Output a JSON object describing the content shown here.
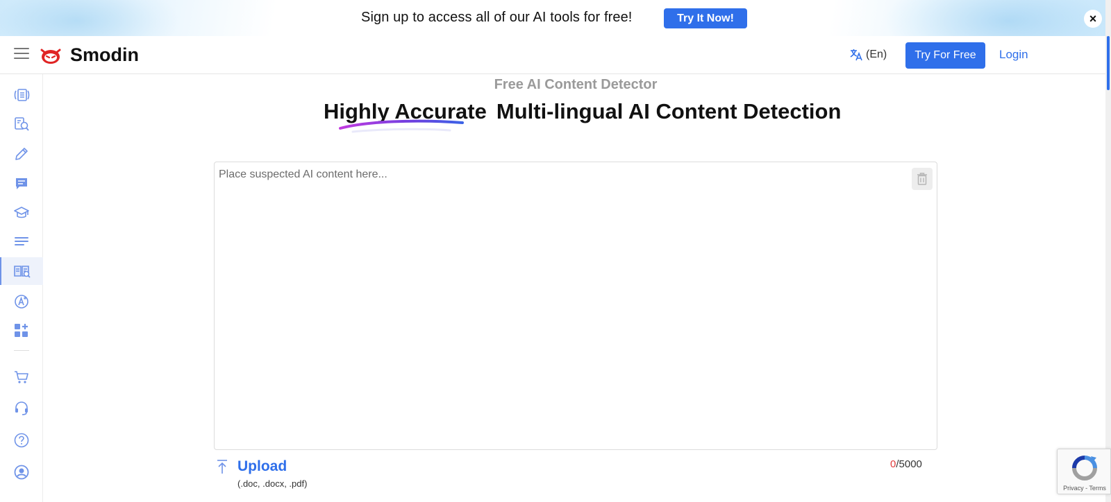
{
  "banner": {
    "text": "Sign up to access all of our AI tools for free!",
    "button_label": "Try It Now!",
    "close_label": "×"
  },
  "header": {
    "brand": "Smodin",
    "language": "(En)",
    "try_free_label": "Try For Free",
    "login_label": "Login"
  },
  "sidebar": {
    "items": [
      {
        "icon": "rewrite-icon"
      },
      {
        "icon": "plagiarism-search-icon"
      },
      {
        "icon": "pencil-icon"
      },
      {
        "icon": "chat-icon"
      },
      {
        "icon": "graduation-cap-icon"
      },
      {
        "icon": "text-lines-icon"
      },
      {
        "icon": "ai-detector-icon",
        "active": true
      },
      {
        "icon": "ai-grader-icon"
      },
      {
        "icon": "apps-add-icon"
      },
      {
        "icon": "cart-icon"
      },
      {
        "icon": "headset-icon"
      },
      {
        "icon": "help-icon"
      },
      {
        "icon": "account-icon"
      }
    ]
  },
  "main": {
    "subtitle": "Free AI Content Detector",
    "title_accent": "Highly Accurate",
    "title_rest": "Multi-lingual AI Content Detection",
    "editor_placeholder": "Place suspected AI content here...",
    "upload_label": "Upload",
    "upload_types": "(.doc, .docx, .pdf)",
    "char_count": "0",
    "char_limit": "/5000"
  },
  "recaptcha": {
    "text": "Privacy - Terms"
  },
  "colors": {
    "accent": "#2f6fea",
    "sidebar_icon": "#6f93e8",
    "counter_current": "#e03a3a"
  }
}
